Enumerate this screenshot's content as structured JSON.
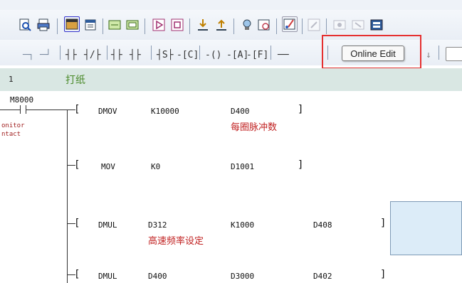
{
  "toolbar_second": {
    "tooltip": "Online Edit"
  },
  "ladder": {
    "rung_number": "1",
    "rung_comment": "打纸",
    "contact_device": "M8000",
    "contact_comment_lines": [
      "onitor",
      "ntact"
    ],
    "rows": [
      {
        "bracket": "[",
        "instruction": "DMOV",
        "op1": "K10000",
        "op2": "D400",
        "op3": "",
        "op2_comment": "每圈脉冲数",
        "op1_comment": "",
        "close": "]"
      },
      {
        "bracket": "[",
        "instruction": "MOV",
        "op1": "K0",
        "op2": "D1001",
        "op3": "",
        "op2_comment": "",
        "op1_comment": "",
        "close": "]"
      },
      {
        "bracket": "[",
        "instruction": "DMUL",
        "op1": "D312",
        "op2": "K1000",
        "op3": "D408",
        "op2_comment": "",
        "op1_comment": "高速频率设定",
        "close": "]"
      },
      {
        "bracket": "[",
        "instruction": "DMUL",
        "op1": "D400",
        "op2": "D3000",
        "op3": "D402",
        "op2_comment": "",
        "op1_comment": "",
        "close": "]"
      }
    ]
  },
  "colors": {
    "highlight": "#e53030",
    "rung_header_bg": "#d9e7e3",
    "comment_red": "#c02020",
    "comment_green": "#4a8a2a"
  }
}
